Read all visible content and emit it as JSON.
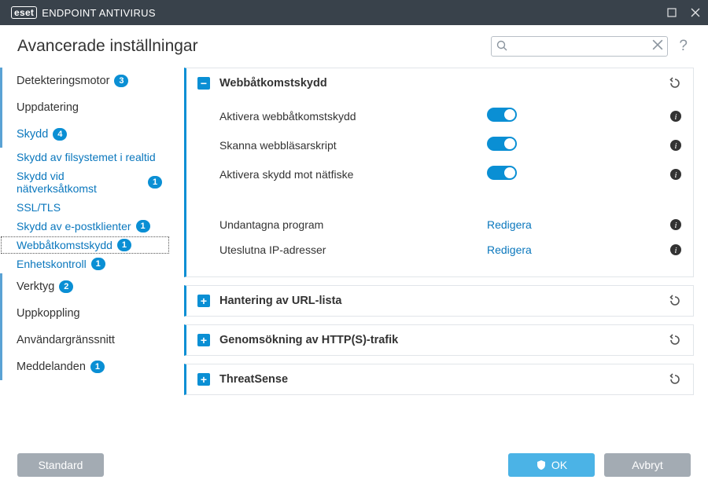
{
  "titlebar": {
    "brand_logo": "eset",
    "product": "ENDPOINT ANTIVIRUS"
  },
  "header": {
    "title": "Avancerade inställningar",
    "search_placeholder": "",
    "help_label": "?"
  },
  "sidebar": {
    "items": [
      {
        "label": "Detekteringsmotor",
        "badge": "3",
        "type": "cat",
        "blue": false
      },
      {
        "label": "Uppdatering",
        "type": "cat"
      },
      {
        "label": "Skydd",
        "badge": "4",
        "type": "cat",
        "blue": true
      },
      {
        "label": "Skydd av filsystemet i realtid",
        "type": "sub"
      },
      {
        "label": "Skydd vid nätverksåtkomst",
        "badge": "1",
        "type": "sub"
      },
      {
        "label": "SSL/TLS",
        "type": "sub"
      },
      {
        "label": "Skydd av e-postklienter",
        "badge": "1",
        "type": "sub"
      },
      {
        "label": "Webbåtkomstskydd",
        "badge": "1",
        "type": "sub",
        "selected": true
      },
      {
        "label": "Enhetskontroll",
        "badge": "1",
        "type": "sub"
      },
      {
        "label": "Verktyg",
        "badge": "2",
        "type": "cat"
      },
      {
        "label": "Uppkoppling",
        "type": "cat"
      },
      {
        "label": "Användargränssnitt",
        "type": "cat"
      },
      {
        "label": "Meddelanden",
        "badge": "1",
        "type": "cat"
      }
    ]
  },
  "panels": [
    {
      "title": "Webbåtkomstskydd",
      "expanded": true,
      "rows": [
        {
          "label": "Aktivera webbåtkomstskydd",
          "control": "toggle",
          "on": true
        },
        {
          "label": "Skanna webbläsarskript",
          "control": "toggle",
          "on": true
        },
        {
          "label": "Aktivera skydd mot nätfiske",
          "control": "toggle",
          "on": true
        }
      ],
      "editRows": [
        {
          "label": "Undantagna program",
          "action": "Redigera"
        },
        {
          "label": "Uteslutna IP-adresser",
          "action": "Redigera"
        }
      ]
    },
    {
      "title": "Hantering av URL-lista",
      "expanded": false
    },
    {
      "title": "Genomsökning av HTTP(S)-trafik",
      "expanded": false
    },
    {
      "title": "ThreatSense",
      "expanded": false
    }
  ],
  "footer": {
    "default": "Standard",
    "ok": "OK",
    "cancel": "Avbryt"
  }
}
